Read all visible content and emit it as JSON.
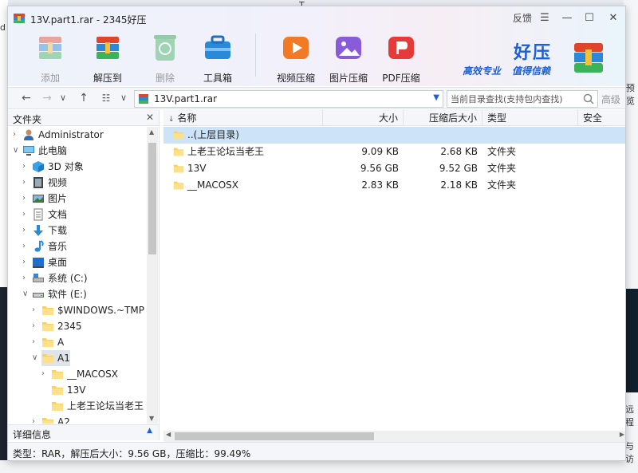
{
  "window": {
    "title": "13V.part1.rar - 2345好压",
    "feedback": "反馈"
  },
  "toolbar": [
    {
      "label": "添加",
      "icon": "add-archive-icon",
      "enabled": false
    },
    {
      "label": "解压到",
      "icon": "extract-to-icon",
      "enabled": true
    },
    {
      "label": "删除",
      "icon": "delete-recycle-icon",
      "enabled": false
    },
    {
      "label": "工具箱",
      "icon": "toolbox-icon",
      "enabled": true
    },
    {
      "label": "视频压缩",
      "icon": "video-compress-icon",
      "enabled": true
    },
    {
      "label": "图片压缩",
      "icon": "image-compress-icon",
      "enabled": true
    },
    {
      "label": "PDF压缩",
      "icon": "pdf-compress-icon",
      "enabled": true
    }
  ],
  "brand": {
    "name": "好压",
    "slogan1": "高效专业",
    "slogan2": "值得信赖"
  },
  "address": {
    "path": "13V.part1.rar",
    "search_placeholder": "当前目录查找(支持包内查找)",
    "advanced": "高级"
  },
  "left_pane": {
    "title": "文件夹",
    "detail_title": "详细信息",
    "tree": [
      {
        "label": "Administrator",
        "icon": "user-icon",
        "depth": 0,
        "expander": ">"
      },
      {
        "label": "此电脑",
        "icon": "computer-icon",
        "depth": 0,
        "expander": "v"
      },
      {
        "label": "3D 对象",
        "icon": "3d-objects-icon",
        "depth": 1,
        "expander": ">"
      },
      {
        "label": "视频",
        "icon": "video-folder-icon",
        "depth": 1,
        "expander": ">"
      },
      {
        "label": "图片",
        "icon": "pictures-folder-icon",
        "depth": 1,
        "expander": ">"
      },
      {
        "label": "文档",
        "icon": "documents-folder-icon",
        "depth": 1,
        "expander": ">"
      },
      {
        "label": "下载",
        "icon": "download-folder-icon",
        "depth": 1,
        "expander": ">"
      },
      {
        "label": "音乐",
        "icon": "music-folder-icon",
        "depth": 1,
        "expander": ">"
      },
      {
        "label": "桌面",
        "icon": "desktop-folder-icon",
        "depth": 1,
        "expander": ">"
      },
      {
        "label": "系统 (C:)",
        "icon": "system-drive-icon",
        "depth": 1,
        "expander": ">"
      },
      {
        "label": "软件 (E:)",
        "icon": "drive-icon",
        "depth": 1,
        "expander": "v"
      },
      {
        "label": "$WINDOWS.~TMP",
        "icon": "folder-icon",
        "depth": 2,
        "expander": ">"
      },
      {
        "label": "2345",
        "icon": "folder-icon",
        "depth": 2,
        "expander": ">"
      },
      {
        "label": "A",
        "icon": "folder-icon",
        "depth": 2,
        "expander": ">"
      },
      {
        "label": "A1",
        "icon": "folder-icon",
        "depth": 2,
        "expander": "v",
        "selected": true
      },
      {
        "label": "__MACOSX",
        "icon": "folder-icon",
        "depth": 3,
        "expander": ">"
      },
      {
        "label": "13V",
        "icon": "folder-icon",
        "depth": 3,
        "expander": ""
      },
      {
        "label": "上老王论坛当老王",
        "icon": "folder-icon",
        "depth": 3,
        "expander": ""
      },
      {
        "label": "A2",
        "icon": "folder-icon",
        "depth": 2,
        "expander": ">"
      }
    ]
  },
  "file_list": {
    "columns": [
      "名称",
      "大小",
      "压缩后大小",
      "类型",
      "安全"
    ],
    "rows": [
      {
        "name": "..(上层目录)",
        "size": "",
        "packed": "",
        "type": "",
        "selected": true
      },
      {
        "name": "上老王论坛当老王",
        "size": "9.09 KB",
        "packed": "2.68 KB",
        "type": "文件夹"
      },
      {
        "name": "13V",
        "size": "9.56 GB",
        "packed": "9.52 GB",
        "type": "文件夹"
      },
      {
        "name": "__MACOSX",
        "size": "2.83 KB",
        "packed": "2.18 KB",
        "type": "文件夹"
      }
    ]
  },
  "status": {
    "text": "类型：RAR，解压后大小：9.56 GB，压缩比：99.49%"
  },
  "background": {
    "chars": [
      "d",
      "T",
      "预览",
      "远程",
      "与访"
    ]
  }
}
